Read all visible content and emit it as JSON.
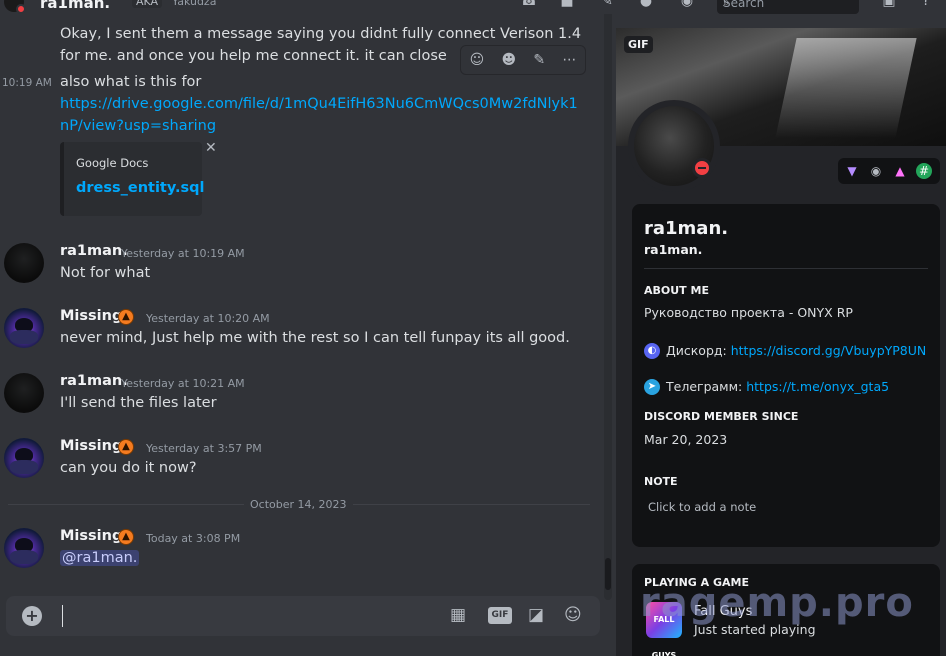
{
  "header": {
    "channel_title": "ra1man.",
    "aka_label": "AKA",
    "aka_name": "Yakudza",
    "search_placeholder": "Search"
  },
  "messages": {
    "m1_line1": "Okay, I sent them a message saying you didnt fully connect Verison 1.4",
    "m1_line2": "for me. and once you help me connect it. it can close",
    "m2_time": "10:19 AM",
    "m2_text": "also what is this for",
    "m2_link1": "https://drive.google.com/file/d/1mQu4EifH63Nu6CmWQcs0Mw2fdNlyk1",
    "m2_link2": "nP/view?usp=sharing",
    "embed_provider": "Google Docs",
    "embed_title": "dress_entity.sql",
    "g1_name": "ra1man.",
    "g1_time": "Yesterday at 10:19 AM",
    "g1_text": "Not for what",
    "g2_name": "Missing",
    "g2_time": "Yesterday at 10:20 AM",
    "g2_text": "never mind, Just help me with the rest so I can tell funpay its all good.",
    "g3_name": "ra1man.",
    "g3_time": "Yesterday at 10:21 AM",
    "g3_text": "I'll send the files later",
    "g4_name": "Missing",
    "g4_time": "Yesterday at 3:57 PM",
    "g4_text": "can you do it now?",
    "date_divider": "October 14, 2023",
    "g5_name": "Missing",
    "g5_time": "Today at 3:08 PM",
    "g5_mention": "@ra1man."
  },
  "composer": {
    "gif_label": "GIF"
  },
  "profile": {
    "gif_badge": "GIF",
    "display_name": "ra1man.",
    "username": "ra1man.",
    "about_heading": "ABOUT ME",
    "about_line1": "Руководство проекта - ONYX RP",
    "discord_label": "Дискорд:",
    "discord_link": "https://discord.gg/VbuypYP8UN",
    "telegram_label": "Телеграмм:",
    "telegram_link": "https://t.me/onyx_gta5",
    "member_since_heading": "DISCORD MEMBER SINCE",
    "member_since": "Mar 20, 2023",
    "note_heading": "NOTE",
    "note_placeholder": "Click to add a note",
    "playing_heading": "PLAYING A GAME",
    "game_name": "Fall Guys",
    "game_state": "Just started playing",
    "game_logo_text": "FALL GUYS"
  },
  "watermark": "ragemp.pro",
  "colors": {
    "link": "#00a8fc",
    "dnd": "#f23f43",
    "mention_bg": "#3c4270"
  }
}
